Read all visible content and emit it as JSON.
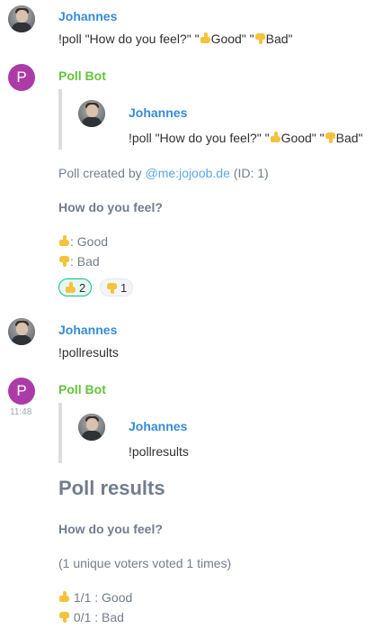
{
  "messages": [
    {
      "sender": "Johannes",
      "text_parts": [
        "!poll \"How do you feel?\" \"",
        "Good\" \"",
        "Bad\""
      ]
    },
    {
      "sender": "Poll Bot",
      "avatar_letter": "P",
      "quote": {
        "sender": "Johannes",
        "text_parts": [
          "!poll \"How do you feel?\" \"",
          "Good\" \"",
          "Bad\""
        ]
      },
      "created_prefix": "Poll created by ",
      "created_link": "@me:jojoob.de",
      "created_suffix": " (ID: 1)",
      "question": "How do you feel?",
      "options": [
        {
          "icon": "thumbs-up-icon",
          "label": ": Good"
        },
        {
          "icon": "thumbs-down-icon",
          "label": ": Bad"
        }
      ],
      "reactions": [
        {
          "icon": "thumbs-up-icon",
          "count": "2",
          "selected": true
        },
        {
          "icon": "thumbs-down-icon",
          "count": "1",
          "selected": false
        }
      ]
    },
    {
      "sender": "Johannes",
      "text": "!pollresults"
    },
    {
      "sender": "Poll Bot",
      "avatar_letter": "P",
      "timestamp": "11:48",
      "quote": {
        "sender": "Johannes",
        "text": "!pollresults"
      },
      "results_title": "Poll results",
      "question": "How do you feel?",
      "voters_line": "(1 unique voters voted 1 times)",
      "results": [
        {
          "icon": "thumbs-up-icon",
          "label": " 1/1 : Good"
        },
        {
          "icon": "thumbs-down-icon",
          "label": " 0/1 : Bad"
        }
      ]
    }
  ],
  "colors": {
    "user_name": "#368bd6",
    "bot_name": "#65c33a",
    "bot_avatar": "#ac3ba8",
    "reaction_selected": "#0dbd8b",
    "link": "#5aa9e6"
  }
}
